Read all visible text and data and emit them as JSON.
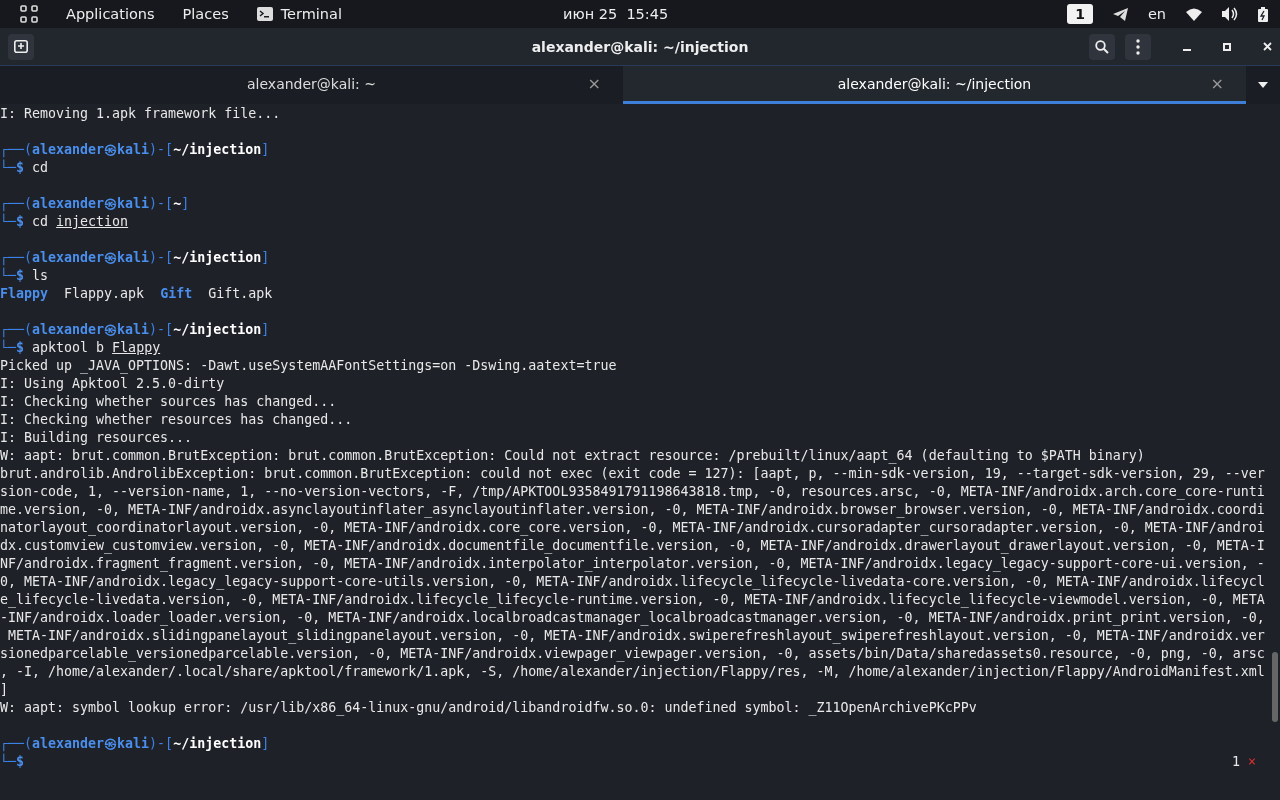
{
  "top_bar": {
    "menus": [
      "Applications",
      "Places"
    ],
    "app": "Terminal",
    "date": "июн 25",
    "time": "15:45",
    "workspace": "1",
    "keyboard_layout": "en"
  },
  "window": {
    "title": "alexander@kali: ~/injection"
  },
  "tabs": [
    {
      "label": "alexander@kali: ~",
      "close": "×",
      "selected": false
    },
    {
      "label": "alexander@kali: ~/injection",
      "close": "×",
      "selected": true
    }
  ],
  "terminal": {
    "rows": [
      {
        "kind": "output",
        "text": "I: Removing 1.apk framework file..."
      },
      {
        "kind": "blank"
      },
      {
        "kind": "prompt",
        "corner_top": "┌──(",
        "user": "alexander",
        "at": "㉿",
        "host": "kali",
        "mid": ")-[",
        "path": "~/injection",
        "end": "]",
        "corner_bottom": "└─",
        "sign": "$",
        "command": "cd"
      },
      {
        "kind": "blank"
      },
      {
        "kind": "prompt",
        "corner_top": "┌──(",
        "user": "alexander",
        "at": "㉿",
        "host": "kali",
        "mid": ")-[",
        "path": "~",
        "end": "]",
        "corner_bottom": "└─",
        "sign": "$",
        "command": "cd",
        "argument": "injection",
        "argument_underlined": true
      },
      {
        "kind": "blank"
      },
      {
        "kind": "prompt",
        "corner_top": "┌──(",
        "user": "alexander",
        "at": "㉿",
        "host": "kali",
        "mid": ")-[",
        "path": "~/injection",
        "end": "]",
        "corner_bottom": "└─",
        "sign": "$",
        "command": "ls"
      },
      {
        "kind": "listing",
        "items": [
          {
            "name": "Flappy",
            "kind": "directory"
          },
          {
            "name": "Flappy.apk",
            "kind": "file"
          },
          {
            "name": "Gift",
            "kind": "directory"
          },
          {
            "name": "Gift.apk",
            "kind": "file"
          }
        ]
      },
      {
        "kind": "blank"
      },
      {
        "kind": "prompt",
        "corner_top": "┌──(",
        "user": "alexander",
        "at": "㉿",
        "host": "kali",
        "mid": ")-[",
        "path": "~/injection",
        "end": "]",
        "corner_bottom": "└─",
        "sign": "$",
        "command": "apktool b",
        "argument": "Flappy",
        "argument_underlined": true
      },
      {
        "kind": "output",
        "text": "Picked up _JAVA_OPTIONS: -Dawt.useSystemAAFontSettings=on -Dswing.aatext=true"
      },
      {
        "kind": "output",
        "text": "I: Using Apktool 2.5.0-dirty"
      },
      {
        "kind": "output",
        "text": "I: Checking whether sources has changed..."
      },
      {
        "kind": "output",
        "text": "I: Checking whether resources has changed..."
      },
      {
        "kind": "output",
        "text": "I: Building resources..."
      },
      {
        "kind": "output",
        "text": "W: aapt: brut.common.BrutException: brut.common.BrutException: Could not extract resource: /prebuilt/linux/aapt_64 (defaulting to $PATH binary)"
      },
      {
        "kind": "output",
        "text": "brut.androlib.AndrolibException: brut.common.BrutException: could not exec (exit code = 127): [aapt, p, --min-sdk-version, 19, --target-sdk-version, 29, --ver"
      },
      {
        "kind": "output",
        "text": "sion-code, 1, --version-name, 1, --no-version-vectors, -F, /tmp/APKTOOL9358491791198643818.tmp, -0, resources.arsc, -0, META-INF/androidx.arch.core_core-runti"
      },
      {
        "kind": "output",
        "text": "me.version, -0, META-INF/androidx.asynclayoutinflater_asynclayoutinflater.version, -0, META-INF/androidx.browser_browser.version, -0, META-INF/androidx.coordi"
      },
      {
        "kind": "output",
        "text": "natorlayout_coordinatorlayout.version, -0, META-INF/androidx.core_core.version, -0, META-INF/androidx.cursoradapter_cursoradapter.version, -0, META-INF/androi"
      },
      {
        "kind": "output",
        "text": "dx.customview_customview.version, -0, META-INF/androidx.documentfile_documentfile.version, -0, META-INF/androidx.drawerlayout_drawerlayout.version, -0, META-I"
      },
      {
        "kind": "output",
        "text": "NF/androidx.fragment_fragment.version, -0, META-INF/androidx.interpolator_interpolator.version, -0, META-INF/androidx.legacy_legacy-support-core-ui.version, -"
      },
      {
        "kind": "output",
        "text": "0, META-INF/androidx.legacy_legacy-support-core-utils.version, -0, META-INF/androidx.lifecycle_lifecycle-livedata-core.version, -0, META-INF/androidx.lifecycl"
      },
      {
        "kind": "output",
        "text": "e_lifecycle-livedata.version, -0, META-INF/androidx.lifecycle_lifecycle-runtime.version, -0, META-INF/androidx.lifecycle_lifecycle-viewmodel.version, -0, META"
      },
      {
        "kind": "output",
        "text": "-INF/androidx.loader_loader.version, -0, META-INF/androidx.localbroadcastmanager_localbroadcastmanager.version, -0, META-INF/androidx.print_print.version, -0,"
      },
      {
        "kind": "output",
        "text": " META-INF/androidx.slidingpanelayout_slidingpanelayout.version, -0, META-INF/androidx.swiperefreshlayout_swiperefreshlayout.version, -0, META-INF/androidx.ver"
      },
      {
        "kind": "output",
        "text": "sionedparcelable_versionedparcelable.version, -0, META-INF/androidx.viewpager_viewpager.version, -0, assets/bin/Data/sharedassets0.resource, -0, png, -0, arsc"
      },
      {
        "kind": "output",
        "text": ", -I, /home/alexander/.local/share/apktool/framework/1.apk, -S, /home/alexander/injection/Flappy/res, -M, /home/alexander/injection/Flappy/AndroidManifest.xml"
      },
      {
        "kind": "output",
        "text": "]"
      },
      {
        "kind": "output",
        "text": "W: aapt: symbol lookup error: /usr/lib/x86_64-linux-gnu/android/libandroidfw.so.0: undefined symbol: _Z11OpenArchivePKcPPv"
      },
      {
        "kind": "blank"
      },
      {
        "kind": "prompt",
        "corner_top": "┌──(",
        "user": "alexander",
        "at": "㉿",
        "host": "kali",
        "mid": ")-[",
        "path": "~/injection",
        "end": "]",
        "corner_bottom": "└─",
        "sign": "$",
        "exit_code": "1",
        "exit_mark": "×"
      }
    ]
  }
}
